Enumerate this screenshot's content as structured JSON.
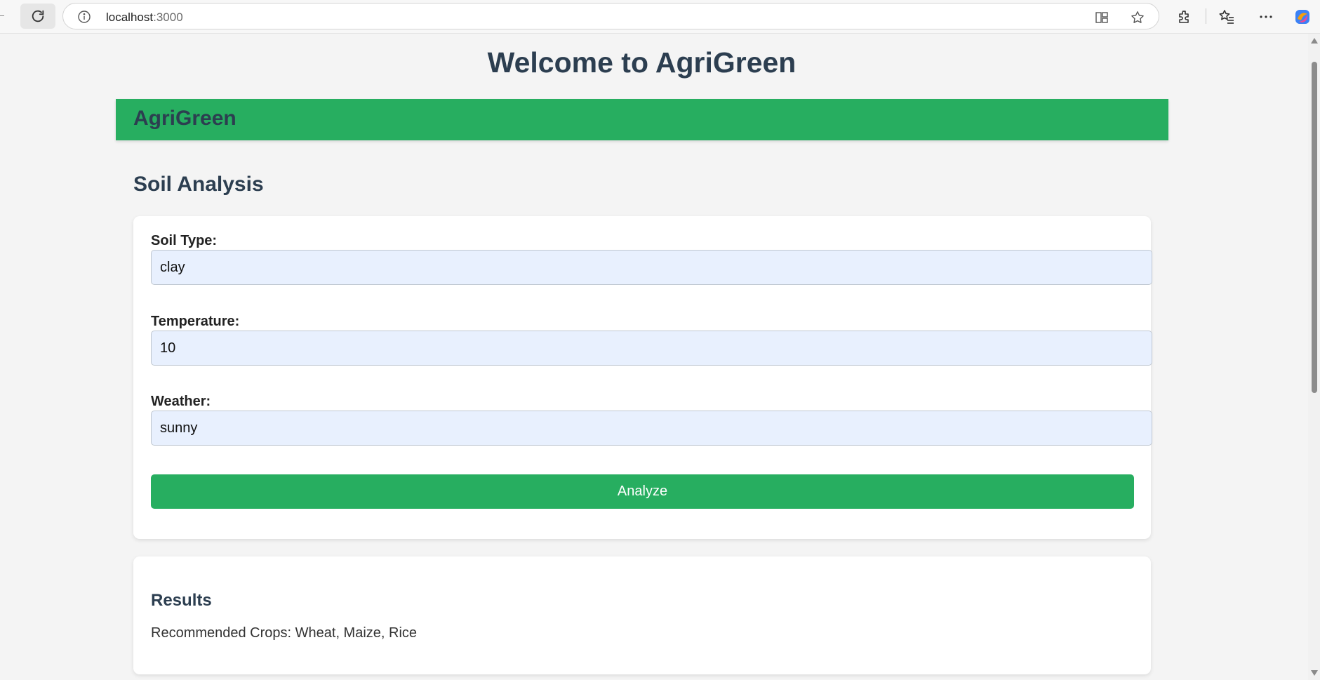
{
  "browser": {
    "url_host": "localhost",
    "url_port": ":3000"
  },
  "page": {
    "title": "Welcome to AgriGreen"
  },
  "header": {
    "brand": "AgriGreen"
  },
  "soil_analysis": {
    "title": "Soil Analysis",
    "fields": [
      {
        "label": "Soil Type:",
        "value": "clay"
      },
      {
        "label": "Temperature:",
        "value": "10"
      },
      {
        "label": "Weather:",
        "value": "sunny"
      }
    ],
    "analyze_label": "Analyze"
  },
  "results": {
    "title": "Results",
    "text": "Recommended Crops: Wheat, Maize, Rice"
  },
  "colors": {
    "brand_green": "#27ae60",
    "heading": "#2c3e50",
    "input_bg": "#e8f0fe"
  }
}
